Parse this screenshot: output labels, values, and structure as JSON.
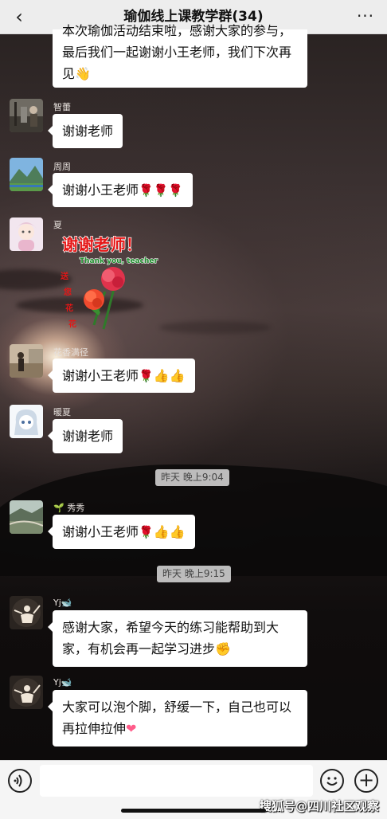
{
  "header": {
    "title": "瑜伽线上课教学群(34)",
    "back_icon": "‹",
    "more_icon": "···"
  },
  "messages": [
    {
      "sender": "",
      "text": "本次瑜伽活动结束啦，感谢大家的参与，最后我们一起谢谢小王老师，我们下次再见"
    },
    {
      "sender": "智蕾",
      "text": "谢谢老师"
    },
    {
      "sender": "周周",
      "text": "谢谢小王老师"
    },
    {
      "sender": "夏",
      "sticker": {
        "line1": "谢谢老师！",
        "line2": "Thank you, teacher",
        "side": "送您花花"
      }
    },
    {
      "sender": "花香满径",
      "text": "谢谢小王老师"
    },
    {
      "sender": "暖夏",
      "text": "谢谢老师"
    },
    {
      "sender": "秀秀",
      "text": "谢谢小王老师"
    },
    {
      "sender": "Yj",
      "text": "感谢大家，希望今天的练习能帮助到大家，有机会再一起学习进步"
    },
    {
      "sender": "Yj",
      "text": "大家可以泡个脚，舒缓一下，自己也可以再拉伸拉伸"
    }
  ],
  "timestamps": [
    "昨天 晚上9:04",
    "昨天 晚上9:15"
  ],
  "input_bar": {
    "placeholder": "",
    "voice_icon": "voice-icon",
    "emoji_icon": "smiley-icon",
    "plus_icon": "plus-icon"
  },
  "watermark": "搜狐号@四川社区观察",
  "colors": {
    "header_bg": "#ededed",
    "bubble_bg": "#ffffff",
    "input_bar_bg": "#f5f5f5"
  }
}
